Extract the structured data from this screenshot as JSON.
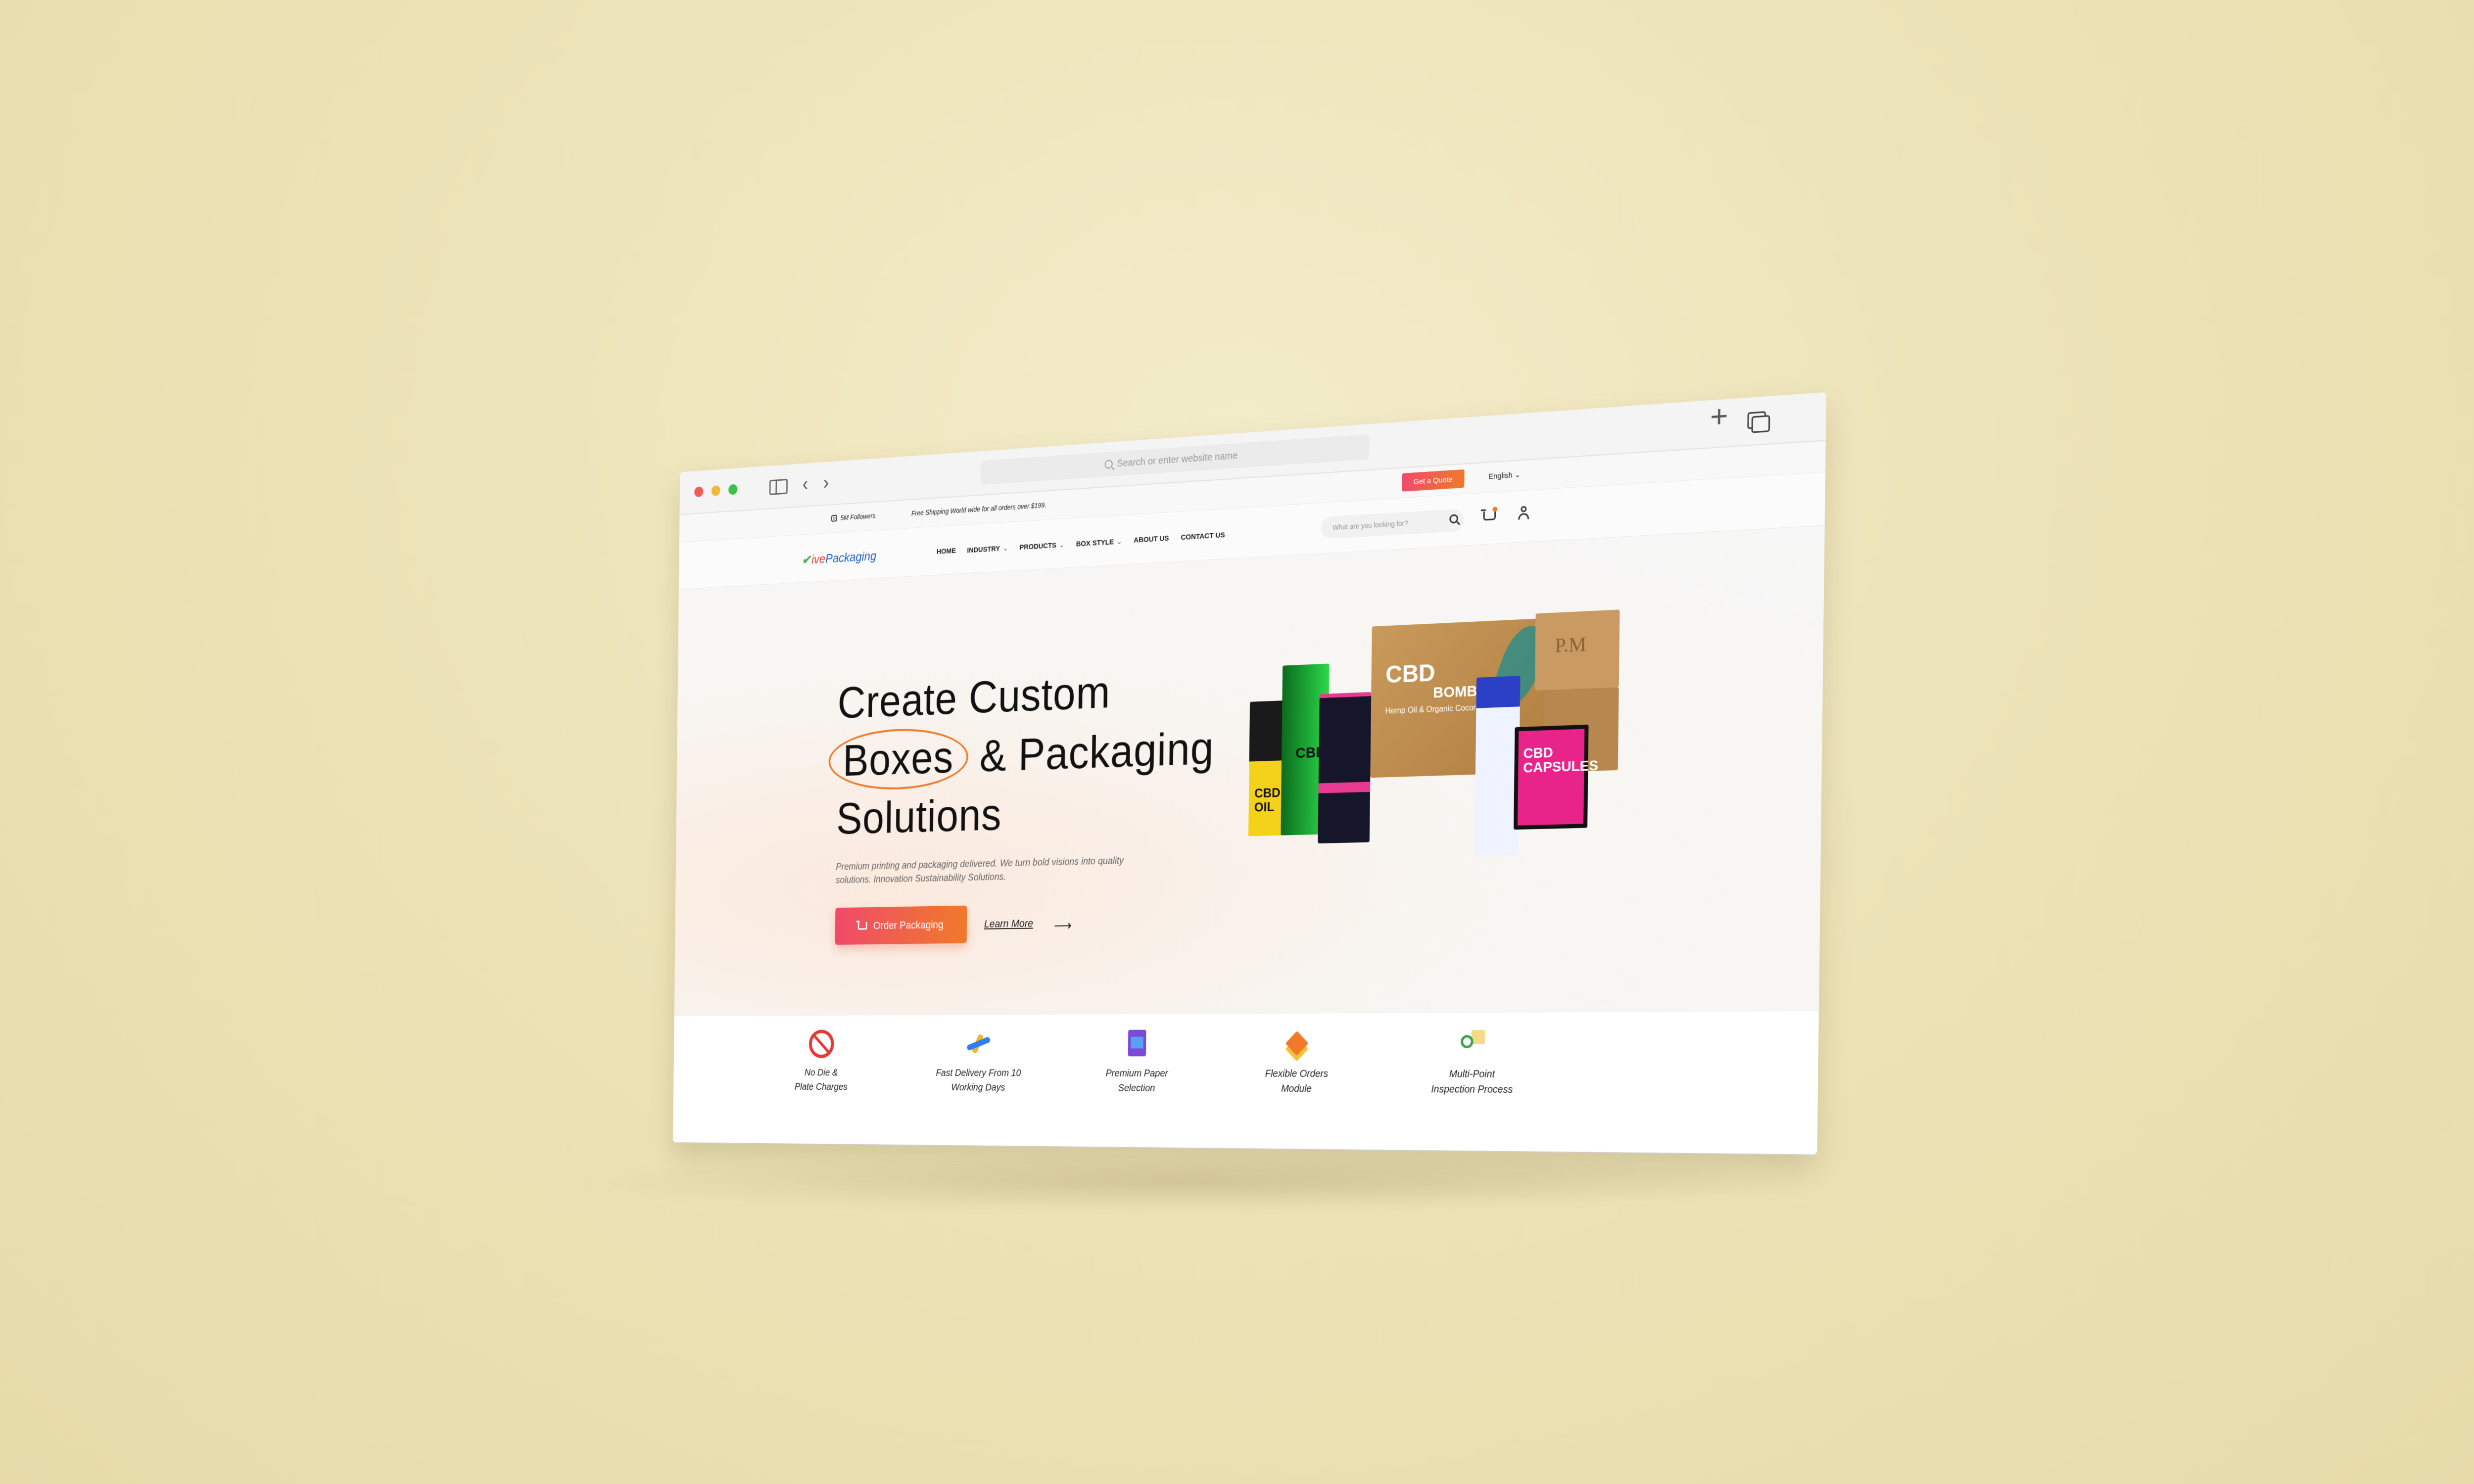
{
  "browser": {
    "address_placeholder": "Search or enter website name"
  },
  "topbar": {
    "followers": "5M Followers",
    "shipping": "Free Shipping World wide for all orders over $199.",
    "quote_button": "Get a Quote",
    "language": "English ⌄"
  },
  "nav": {
    "logo_mark": "✔",
    "logo_part1": "ive",
    "logo_part2": "Packaging",
    "items": [
      {
        "label": "HOME",
        "chevron": ""
      },
      {
        "label": "INDUSTRY",
        "chevron": "⌄"
      },
      {
        "label": "PRODUCTS",
        "chevron": "⌄"
      },
      {
        "label": "BOX STYLE",
        "chevron": "⌄"
      },
      {
        "label": "ABOUT US",
        "chevron": ""
      },
      {
        "label": "CONTACT US",
        "chevron": ""
      }
    ],
    "search_placeholder": "What are you looking for?"
  },
  "hero": {
    "title_line1": "Create Custom",
    "title_highlight": "Boxes",
    "title_line2_rest": " & Packaging",
    "title_line3": "Solutions",
    "description": "Premium printing and packaging delivered. We turn bold visions into quality solutions. Innovation Sustainability Solutions.",
    "order_button": "Order Packaging",
    "learn_more": "Learn More",
    "arrow": "⟶"
  },
  "product_image": {
    "oil_label": "CBD OIL",
    "cbd_label": "CBD",
    "box_title": "CBD",
    "box_subtitle": "BOMBS",
    "box_text": "Hemp Oil & Organic Coconut Oil",
    "pm_label": "P.M",
    "capsules_label": "CBD CAPSULES"
  },
  "features": [
    {
      "icon": "no-die-icon",
      "line1": "No Die &",
      "line2": "Plate Charges"
    },
    {
      "icon": "fast-delivery-icon",
      "line1": "Fast Delivery From 10",
      "line2": "Working Days"
    },
    {
      "icon": "premium-paper-icon",
      "line1": "Premium Paper",
      "line2": "Selection"
    },
    {
      "icon": "flexible-orders-icon",
      "line1": "Flexible Orders",
      "line2": "Module"
    },
    {
      "icon": "inspection-icon",
      "line1": "Multi-Point",
      "line2": "Inspection Process"
    }
  ],
  "colors": {
    "accent_start": "#f04a6b",
    "accent_end": "#f07a2a",
    "background": "#ede3b8"
  }
}
